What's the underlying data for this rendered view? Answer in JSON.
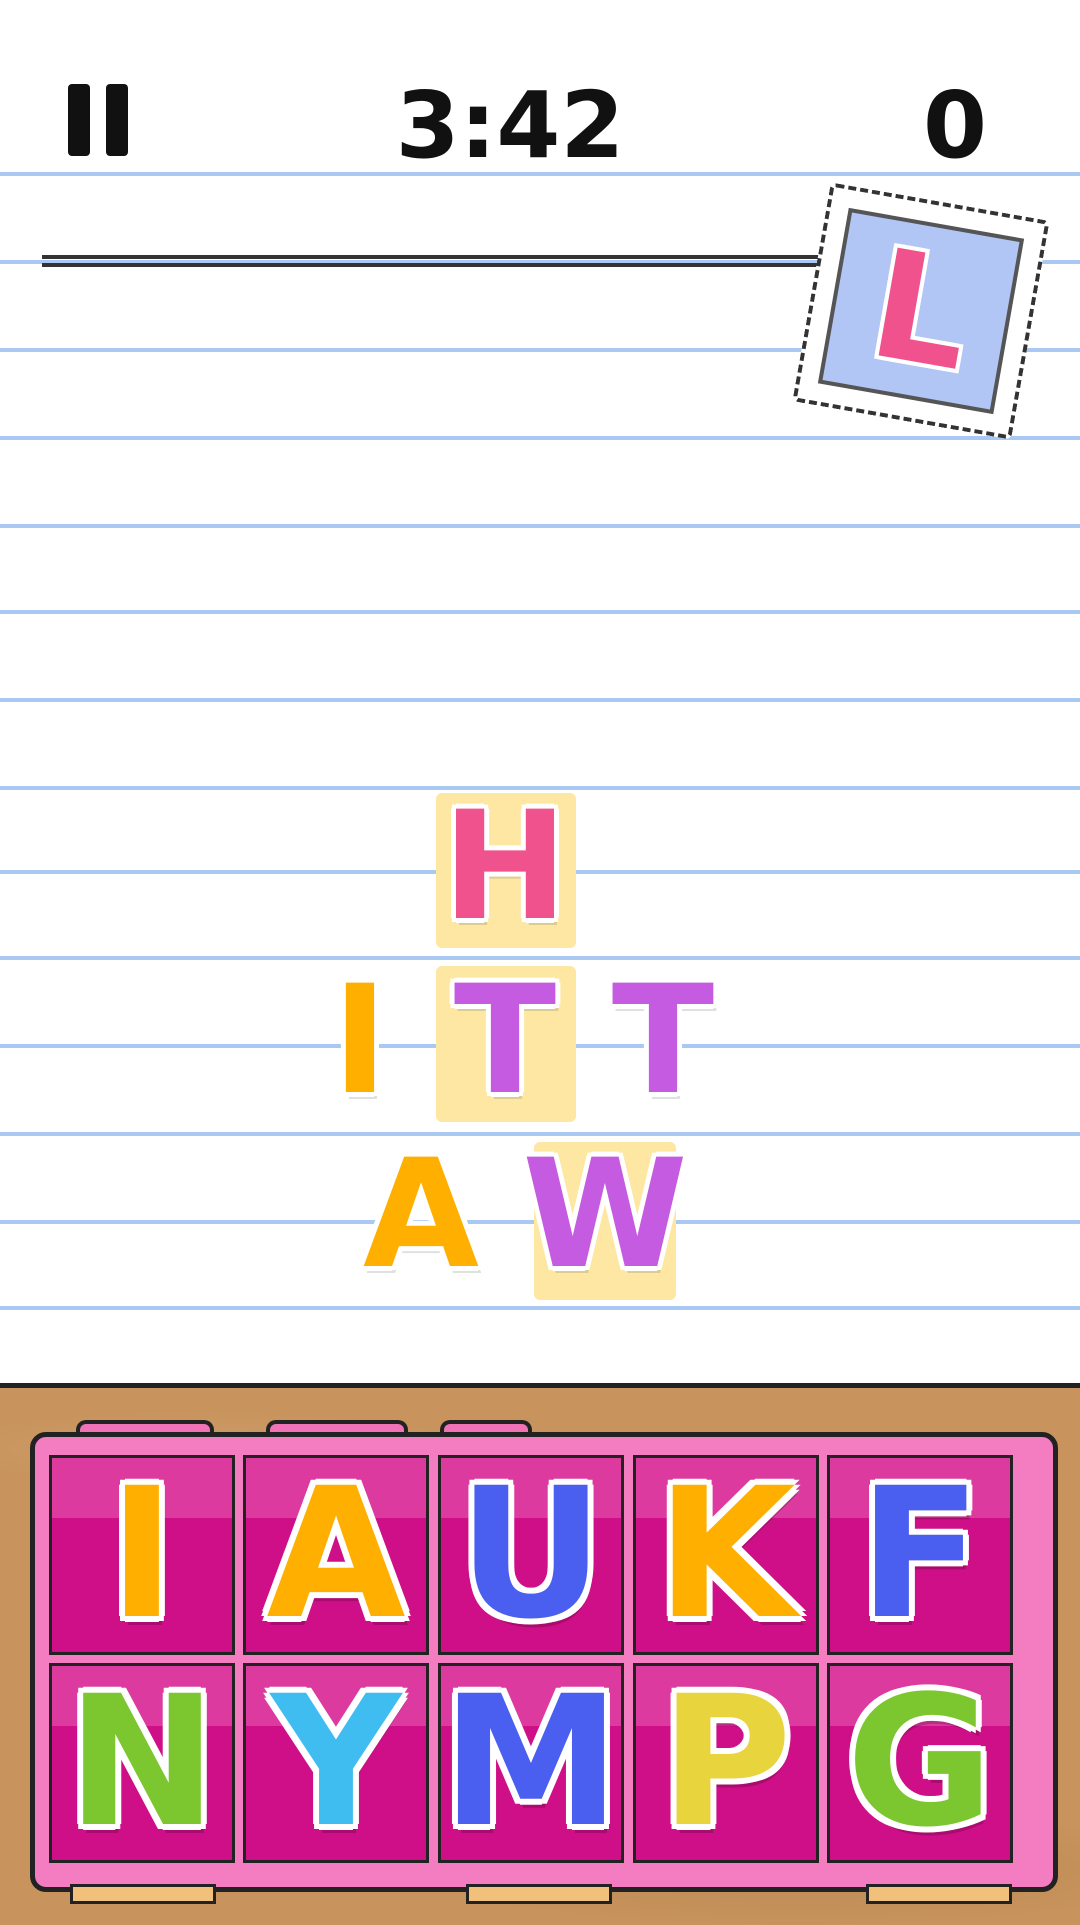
{
  "hud": {
    "timer": "3:42",
    "score": "0"
  },
  "stamp": {
    "letter": "L",
    "color": "#f0528e",
    "background": "#b2c6f5"
  },
  "board": {
    "tiles": [
      {
        "letter": "H",
        "color": "#f0528e",
        "highlighted": true
      },
      {
        "letter": "I",
        "color": "#ffaf00",
        "highlighted": false
      },
      {
        "letter": "T",
        "color": "#c45be0",
        "highlighted": true
      },
      {
        "letter": "T",
        "color": "#c45be0",
        "highlighted": false
      },
      {
        "letter": "A",
        "color": "#ffaf00",
        "highlighted": false
      },
      {
        "letter": "W",
        "color": "#c45be0",
        "highlighted": true
      }
    ]
  },
  "tray": {
    "top_row": [
      {
        "letter": "I",
        "color": "#ffaf00"
      },
      {
        "letter": "A",
        "color": "#ffaf00"
      },
      {
        "letter": "U",
        "color": "#4a5ff0"
      },
      {
        "letter": "K",
        "color": "#ffaf00"
      },
      {
        "letter": "F",
        "color": "#4a5ff0"
      }
    ],
    "bottom_row": [
      {
        "letter": "N",
        "color": "#7cc62f"
      },
      {
        "letter": "Y",
        "color": "#3fbdf0"
      },
      {
        "letter": "M",
        "color": "#4a5ff0"
      },
      {
        "letter": "P",
        "color": "#e8d43c"
      },
      {
        "letter": "G",
        "color": "#7cc62f"
      }
    ]
  },
  "icons": {
    "pause": "pause-icon"
  }
}
